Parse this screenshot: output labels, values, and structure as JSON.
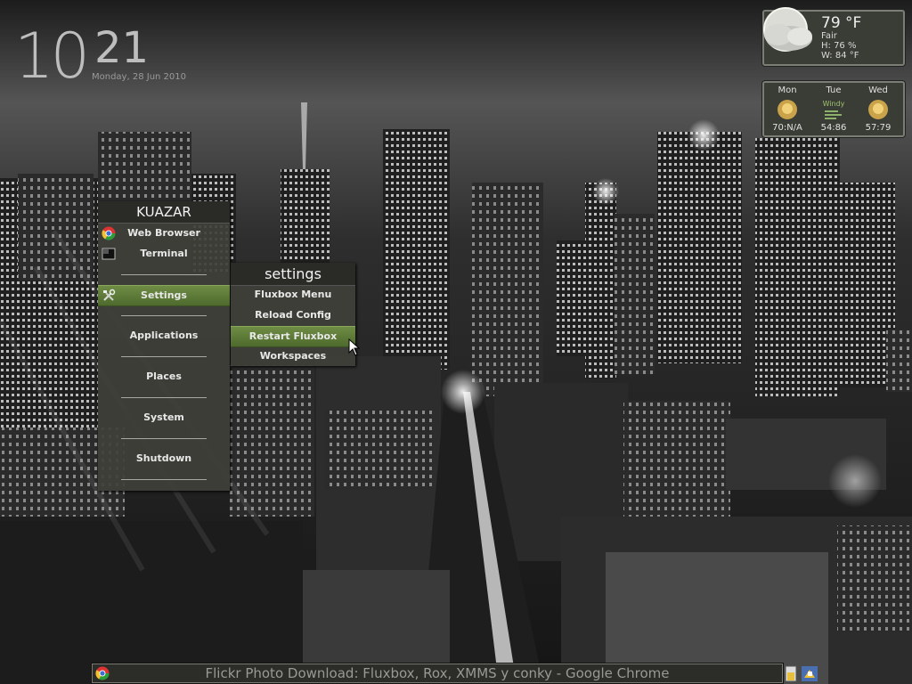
{
  "clock": {
    "hour": "10",
    "minute": "21",
    "date": "Monday, 28 Jun 2010"
  },
  "weather": {
    "icon": "cloud-moon-icon",
    "temperature": "79 °F",
    "condition": "Fair",
    "humidity": "H: 76 %",
    "wind": "W: 84 °F"
  },
  "forecast": [
    {
      "day": "Mon",
      "icon": "sun-icon",
      "note": "",
      "temps": "70:N/A"
    },
    {
      "day": "Tue",
      "icon": "windy-icon",
      "note": "Windy",
      "temps": "54:86"
    },
    {
      "day": "Wed",
      "icon": "sun-icon",
      "note": "",
      "temps": "57:79"
    }
  ],
  "menu": {
    "title": "KUAZAR",
    "items": [
      {
        "label": "Web Browser",
        "icon": "chrome-icon"
      },
      {
        "label": "Terminal",
        "icon": "terminal-icon"
      },
      {
        "label": "Settings",
        "icon": "tools-icon",
        "active": true
      },
      {
        "label": "Applications"
      },
      {
        "label": "Places"
      },
      {
        "label": "System"
      },
      {
        "label": "Shutdown"
      }
    ]
  },
  "submenu": {
    "title": "settings",
    "items": [
      {
        "label": "Fluxbox Menu"
      },
      {
        "label": "Reload Config"
      },
      {
        "label": "Restart Fluxbox",
        "active": true
      },
      {
        "label": "Workspaces"
      }
    ]
  },
  "taskbar": {
    "window_title": "Flickr Photo Download: Fluxbox, Rox, XMMS y conky - Google Chrome",
    "icon": "chrome-icon"
  },
  "colors": {
    "accent": "#5e7a38",
    "menu_bg": "#40403a",
    "text": "#e8e8e8"
  }
}
